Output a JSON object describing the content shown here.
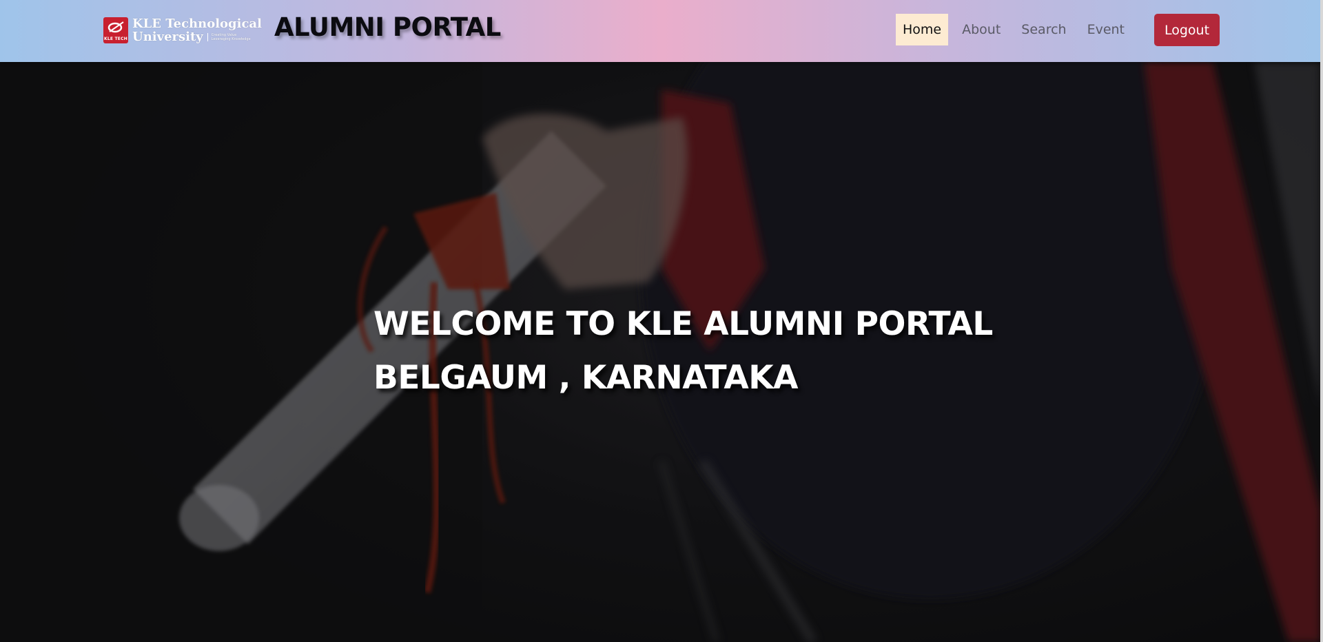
{
  "brand": {
    "logo_small_text": "KLE TECH",
    "logo_line1": "KLE Technological",
    "logo_line2": "University",
    "tagline_line1": "Creating Value",
    "tagline_line2": "Leveraging Knowledge",
    "portal_title": "ALUMNI PORTAL"
  },
  "nav": {
    "items": [
      {
        "label": "Home",
        "active": true
      },
      {
        "label": "About",
        "active": false
      },
      {
        "label": "Search",
        "active": false
      },
      {
        "label": "Event",
        "active": false
      }
    ],
    "logout_label": "Logout"
  },
  "hero": {
    "heading_line1": "WELCOME TO KLE ALUMNI PORTAL",
    "heading_line2": "BELGAUM , KARNATAKA",
    "background_image": "graduate-holding-diploma-photo"
  },
  "colors": {
    "logout_bg": "#b3283a",
    "active_nav_bg": "#fdebd2",
    "logo_red": "#c8202f"
  }
}
